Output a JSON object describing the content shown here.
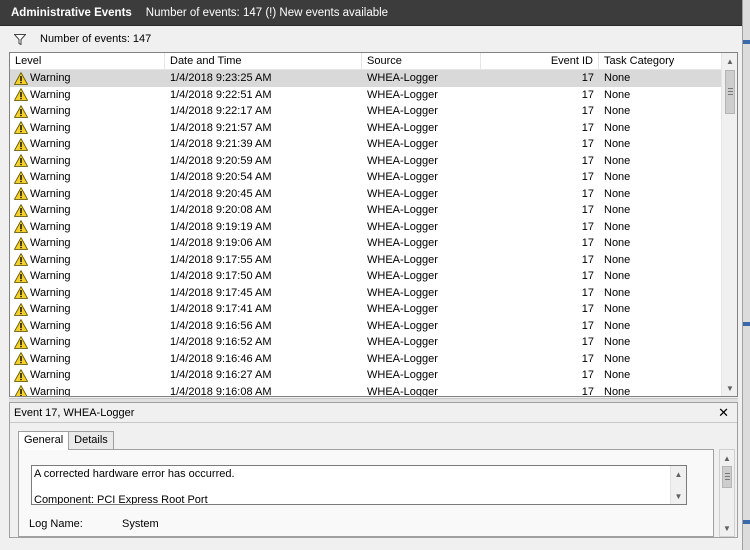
{
  "titlebar": {
    "title": "Administrative Events",
    "subtitle": "Number of events: 147 (!) New events available"
  },
  "filterbar": {
    "icon": "filter-icon",
    "count_text": "Number of events: 147"
  },
  "grid": {
    "columns": [
      "Level",
      "Date and Time",
      "Source",
      "Event ID",
      "Task Category"
    ],
    "rows": [
      {
        "level": "Warning",
        "datetime": "1/4/2018 9:23:25 AM",
        "source": "WHEA-Logger",
        "event_id": "17",
        "category": "None"
      },
      {
        "level": "Warning",
        "datetime": "1/4/2018 9:22:51 AM",
        "source": "WHEA-Logger",
        "event_id": "17",
        "category": "None"
      },
      {
        "level": "Warning",
        "datetime": "1/4/2018 9:22:17 AM",
        "source": "WHEA-Logger",
        "event_id": "17",
        "category": "None"
      },
      {
        "level": "Warning",
        "datetime": "1/4/2018 9:21:57 AM",
        "source": "WHEA-Logger",
        "event_id": "17",
        "category": "None"
      },
      {
        "level": "Warning",
        "datetime": "1/4/2018 9:21:39 AM",
        "source": "WHEA-Logger",
        "event_id": "17",
        "category": "None"
      },
      {
        "level": "Warning",
        "datetime": "1/4/2018 9:20:59 AM",
        "source": "WHEA-Logger",
        "event_id": "17",
        "category": "None"
      },
      {
        "level": "Warning",
        "datetime": "1/4/2018 9:20:54 AM",
        "source": "WHEA-Logger",
        "event_id": "17",
        "category": "None"
      },
      {
        "level": "Warning",
        "datetime": "1/4/2018 9:20:45 AM",
        "source": "WHEA-Logger",
        "event_id": "17",
        "category": "None"
      },
      {
        "level": "Warning",
        "datetime": "1/4/2018 9:20:08 AM",
        "source": "WHEA-Logger",
        "event_id": "17",
        "category": "None"
      },
      {
        "level": "Warning",
        "datetime": "1/4/2018 9:19:19 AM",
        "source": "WHEA-Logger",
        "event_id": "17",
        "category": "None"
      },
      {
        "level": "Warning",
        "datetime": "1/4/2018 9:19:06 AM",
        "source": "WHEA-Logger",
        "event_id": "17",
        "category": "None"
      },
      {
        "level": "Warning",
        "datetime": "1/4/2018 9:17:55 AM",
        "source": "WHEA-Logger",
        "event_id": "17",
        "category": "None"
      },
      {
        "level": "Warning",
        "datetime": "1/4/2018 9:17:50 AM",
        "source": "WHEA-Logger",
        "event_id": "17",
        "category": "None"
      },
      {
        "level": "Warning",
        "datetime": "1/4/2018 9:17:45 AM",
        "source": "WHEA-Logger",
        "event_id": "17",
        "category": "None"
      },
      {
        "level": "Warning",
        "datetime": "1/4/2018 9:17:41 AM",
        "source": "WHEA-Logger",
        "event_id": "17",
        "category": "None"
      },
      {
        "level": "Warning",
        "datetime": "1/4/2018 9:16:56 AM",
        "source": "WHEA-Logger",
        "event_id": "17",
        "category": "None"
      },
      {
        "level": "Warning",
        "datetime": "1/4/2018 9:16:52 AM",
        "source": "WHEA-Logger",
        "event_id": "17",
        "category": "None"
      },
      {
        "level": "Warning",
        "datetime": "1/4/2018 9:16:46 AM",
        "source": "WHEA-Logger",
        "event_id": "17",
        "category": "None"
      },
      {
        "level": "Warning",
        "datetime": "1/4/2018 9:16:27 AM",
        "source": "WHEA-Logger",
        "event_id": "17",
        "category": "None"
      },
      {
        "level": "Warning",
        "datetime": "1/4/2018 9:16:08 AM",
        "source": "WHEA-Logger",
        "event_id": "17",
        "category": "None"
      }
    ],
    "selected_index": 0,
    "row_icon": "warning-icon"
  },
  "detail": {
    "title": "Event 17, WHEA-Logger",
    "close_icon": "close-icon",
    "tabs": [
      {
        "label": "General",
        "active": true
      },
      {
        "label": "Details",
        "active": false
      }
    ],
    "message_lines": [
      "A corrected hardware error has occurred.",
      "Component: PCI Express Root Port"
    ],
    "log_name_label": "Log Name:",
    "log_name_value": "System"
  },
  "colors": {
    "titlebar_bg": "#3c3c3c",
    "selection_bg": "#d9d9d9",
    "warning_yellow": "#f5d22b",
    "accent_blue": "#3a68a8"
  }
}
